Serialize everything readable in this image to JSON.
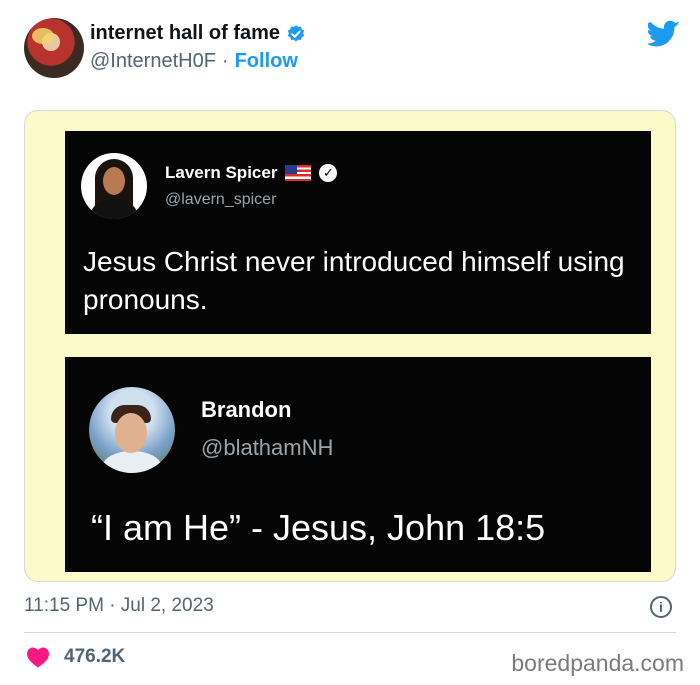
{
  "tweet": {
    "author_name": "internet hall of fame",
    "author_handle": "@InternetH0F",
    "separator": "·",
    "follow_label": "Follow",
    "timestamp": "11:15 PM · Jul 2, 2023",
    "like_count": "476.2K",
    "brand_color": "#1d9bf0",
    "like_color": "#f91880",
    "icons": [
      "verified-badge-icon",
      "twitter-bird-icon",
      "info-icon",
      "heart-icon"
    ]
  },
  "embedded": {
    "first": {
      "name": "Lavern Spicer",
      "handle": "@lavern_spicer",
      "text": "Jesus Christ never introduced himself using pronouns."
    },
    "second": {
      "name": "Brandon",
      "handle": "@blathamNH",
      "text": "“I am He” - Jesus, John 18:5"
    }
  },
  "watermark": "boredpanda.com"
}
